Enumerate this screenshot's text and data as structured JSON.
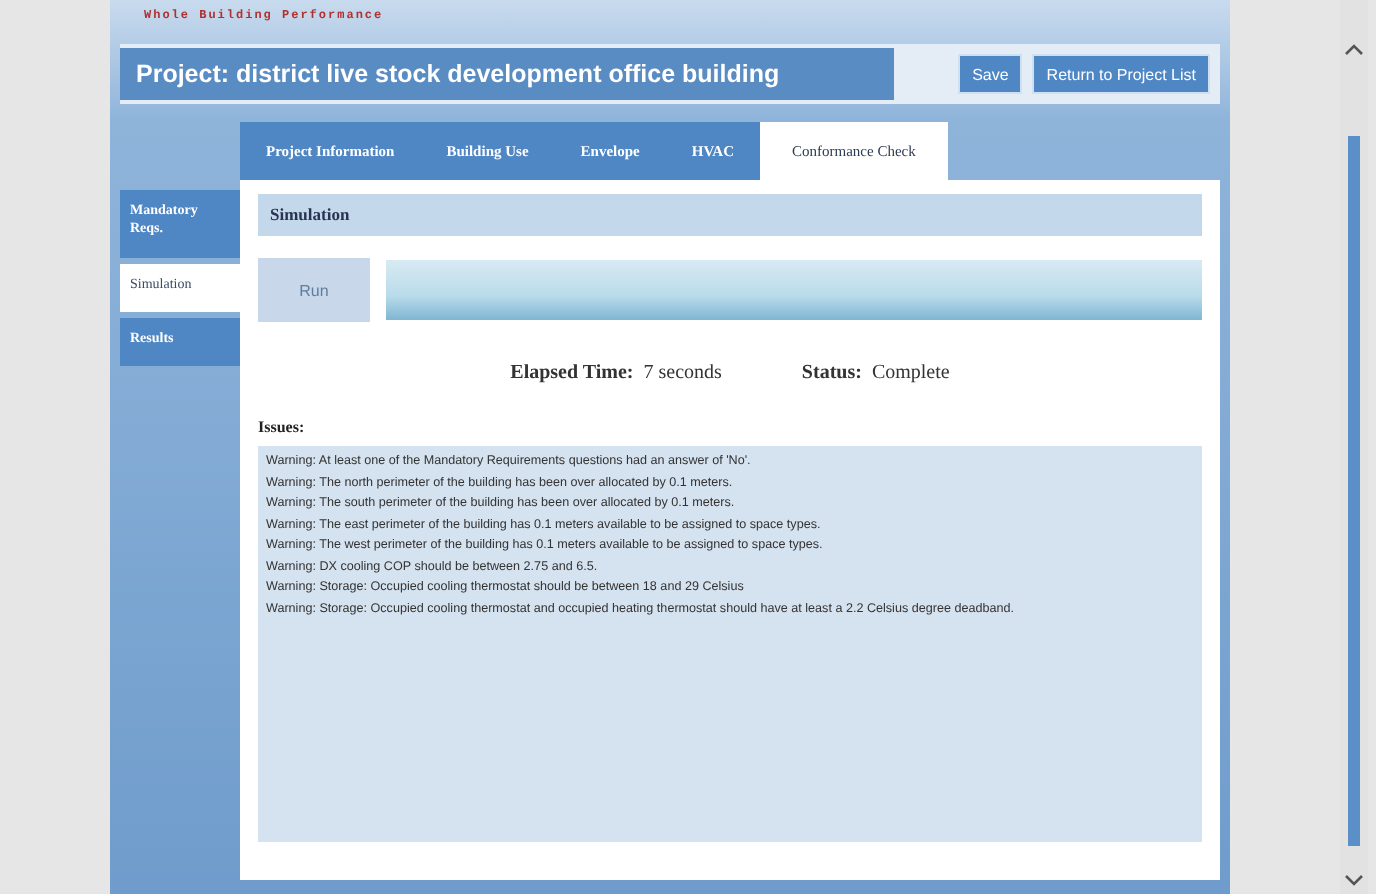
{
  "header": {
    "logo_text": "Whole Building Performance"
  },
  "project_bar": {
    "label": "Project:",
    "name": "district live stock development office building",
    "buttons": [
      "Save",
      "Return to Project List"
    ]
  },
  "tabs": [
    {
      "label": "Project Information",
      "selected": false
    },
    {
      "label": "Building Use",
      "selected": false
    },
    {
      "label": "Envelope",
      "selected": false
    },
    {
      "label": "HVAC",
      "selected": false
    },
    {
      "label": "Conformance Check",
      "selected": true
    }
  ],
  "sidebar": {
    "items": [
      {
        "label": "Mandatory Reqs.",
        "selected": false
      },
      {
        "label": "Simulation",
        "selected": true
      },
      {
        "label": "Results",
        "selected": false
      }
    ]
  },
  "simulation": {
    "title": "Simulation",
    "run_button": {
      "label": "Run",
      "disabled": true
    },
    "progress": {
      "level": 1
    },
    "elapsed_label": "Elapsed Time:",
    "elapsed_value": "7 seconds",
    "status_label": "Status:",
    "status_value": "Complete"
  },
  "issues": {
    "title": "Issues:",
    "lines": [
      "Warning: At least one of the Mandatory Requirements questions had an answer of 'No'.",
      "Warning: The north perimeter of the building has been over allocated by 0.1 meters.",
      "Warning: The south perimeter of the building has been over allocated by 0.1 meters.",
      "Warning: The east perimeter of the building has 0.1 meters available to be assigned to space types.",
      "Warning: The west perimeter of the building has 0.1 meters available to be assigned to space types.",
      "Warning: DX cooling COP should be between 2.75 and 6.5.",
      "Warning: Storage: Occupied cooling thermostat should be between 18 and 29 Celsius",
      "Warning: Storage: Occupied cooling thermostat and occupied heating thermostat should have at least a 2.2 Celsius degree deadband."
    ]
  }
}
